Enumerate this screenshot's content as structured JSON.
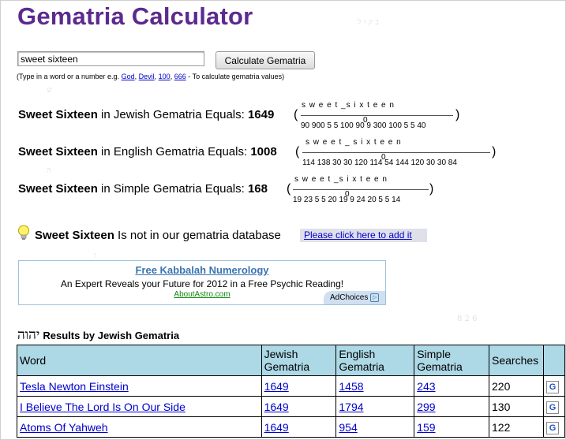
{
  "title": "Gematria Calculator",
  "search": {
    "value": "sweet sixteen",
    "button": "Calculate Gematria"
  },
  "hint": {
    "prefix": "(Type in a word or a number e.g.",
    "examples": [
      "God",
      "Devil",
      "100",
      "666"
    ],
    "suffix": "- To calculate gematria values)"
  },
  "results": [
    {
      "phrase": "Sweet Sixteen",
      "label": " in Jewish Gematria Equals: ",
      "value": "1649",
      "letters": "s w e e t _s i x t e e n",
      "numbers": "90 900 5 5 100 90 9 300 100 5 5 40",
      "zero": "0"
    },
    {
      "phrase": "Sweet Sixteen",
      "label": " in English Gematria Equals: ",
      "value": "1008",
      "letters": "s w e e t _ s i x t e e n",
      "numbers": "114 138 30 30 120 114 54 144 120 30 30 84",
      "zero": "0"
    },
    {
      "phrase": "Sweet Sixteen",
      "label": " in Simple Gematria Equals: ",
      "value": "168",
      "letters": "s w e e t _s i x t e e n",
      "numbers": "19 23 5 5 20 19 9 24 20 5 5 14",
      "zero": "0"
    }
  ],
  "notfound": {
    "phrase": "Sweet Sixteen",
    "text": " Is not in our gematria database",
    "link": "Please click here to add it"
  },
  "ad": {
    "title": "Free Kabbalah Numerology",
    "text": "An Expert Reveals your Future for 2012 in a Free Psychic Reading!",
    "url": "AboutAstro.com",
    "choices": "AdChoices"
  },
  "table": {
    "hebrew": "יהוה",
    "title": "Results by Jewish Gematria",
    "headers": [
      "Word",
      "Jewish Gematria",
      "English Gematria",
      "Simple Gematria",
      "Searches"
    ],
    "rows": [
      {
        "word": "Tesla Newton Einstein",
        "jewish": "1649",
        "english": "1458",
        "simple": "243",
        "searches": "220"
      },
      {
        "word": "I Believe The Lord Is On Our Side",
        "jewish": "1649",
        "english": "1794",
        "simple": "299",
        "searches": "130"
      },
      {
        "word": "Atoms Of Yahweh",
        "jewish": "1649",
        "english": "954",
        "simple": "159",
        "searches": "122"
      }
    ]
  },
  "icons": {
    "google": "google-search-icon",
    "bulb": "lightbulb-icon"
  }
}
